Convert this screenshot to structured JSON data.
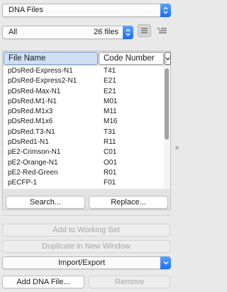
{
  "file_type_select": {
    "value": "DNA Files"
  },
  "filter": {
    "value": "All",
    "count": "26 files"
  },
  "view_icons": [
    "list-view-icon",
    "indented-list-view-icon"
  ],
  "table": {
    "columns": [
      "File Name",
      "Code Number"
    ],
    "rows": [
      [
        "pDsRed-Express-N1",
        "T41"
      ],
      [
        "pDsRed-Express2-N1",
        "E21"
      ],
      [
        "pDsRed-Max-N1",
        "E21"
      ],
      [
        "pDsRed.M1-N1",
        "M01"
      ],
      [
        "pDsRed.M1x3",
        "M11"
      ],
      [
        "pDsRed.M1x6",
        "M16"
      ],
      [
        "pDsRed.T3-N1",
        "T31"
      ],
      [
        "pDsRed1-N1",
        "R11"
      ],
      [
        "pE2-Crimson-N1",
        "C01"
      ],
      [
        "pE2-Orange-N1",
        "O01"
      ],
      [
        "pE2-Red-Green",
        "R01"
      ],
      [
        "pECFP-1",
        "F01"
      ]
    ]
  },
  "buttons": {
    "search": "Search...",
    "replace": "Replace...",
    "add_working_set": "Add to Working Set",
    "duplicate_window": "Duplicate in New Window",
    "import_export": "Import/Export",
    "add_dna_file": "Add DNA File...",
    "remove": "Remove"
  },
  "colors": {
    "accent": "#1c6ef1",
    "header_selected": "#cfe0f6"
  }
}
